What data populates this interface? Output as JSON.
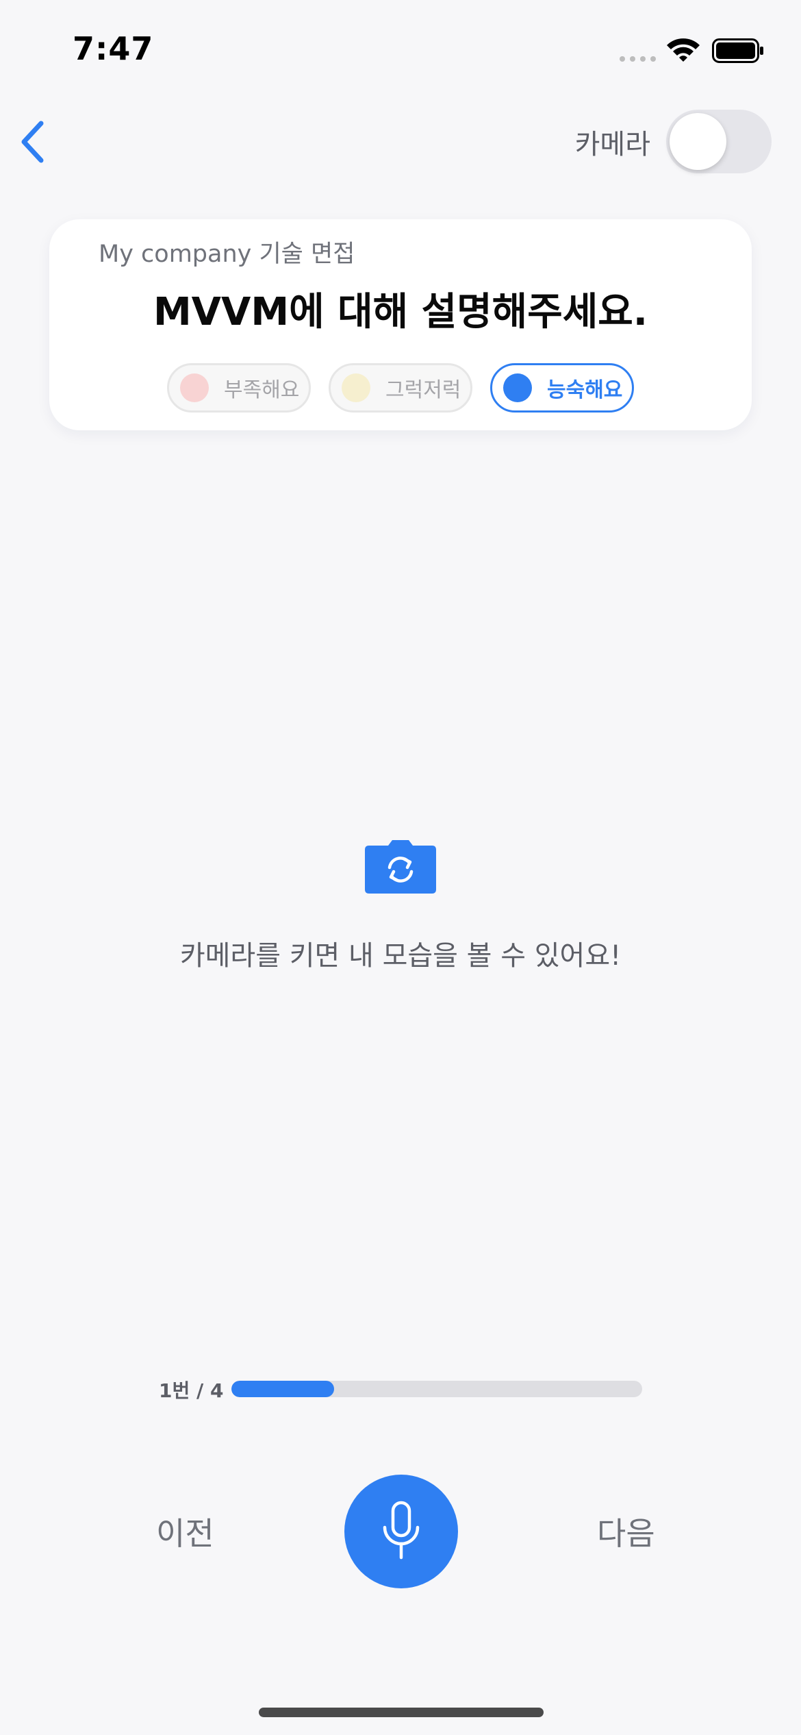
{
  "status_bar": {
    "time": "7:47"
  },
  "nav": {
    "camera_label": "카메라",
    "camera_on": false
  },
  "question_card": {
    "subtitle": "My company 기술 면접",
    "question": "MVVM에 대해 설명해주세요.",
    "ratings": [
      {
        "label": "부족해요",
        "color": "#f5c9c9",
        "selected": false
      },
      {
        "label": "그럭저럭",
        "color": "#f3e9c2",
        "selected": false
      },
      {
        "label": "능숙해요",
        "color": "#2f7ff2",
        "selected": true
      }
    ]
  },
  "camera_placeholder": {
    "message": "카메라를 키면 내 모습을 볼 수 있어요!"
  },
  "progress": {
    "label": "1번 / 4",
    "current": 1,
    "total": 4
  },
  "controls": {
    "prev_label": "이전",
    "next_label": "다음"
  },
  "colors": {
    "accent": "#2f7ff2",
    "background": "#f7f7f9"
  }
}
